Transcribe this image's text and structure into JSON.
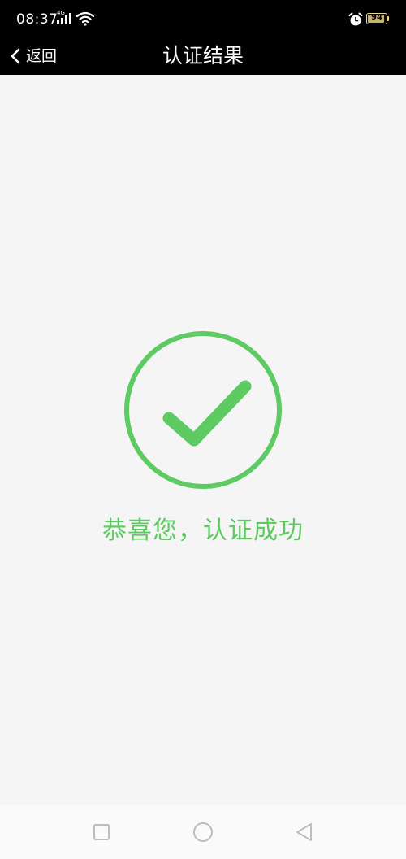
{
  "status_bar": {
    "time": "08:37",
    "network_type": "4G",
    "battery_level": "94",
    "icons": [
      "signal-icon",
      "wifi-icon",
      "alarm-icon",
      "battery-icon"
    ]
  },
  "header": {
    "back_label": "返回",
    "title": "认证结果"
  },
  "result": {
    "status_icon": "check-circle-icon",
    "message": "恭喜您，认证成功",
    "accent_color": "#5dca62"
  },
  "system_nav": {
    "buttons": [
      "recent-apps",
      "home",
      "back"
    ]
  },
  "colors": {
    "header_background": "#000000",
    "page_background": "#f5f5f5",
    "success": "#5dca62"
  }
}
